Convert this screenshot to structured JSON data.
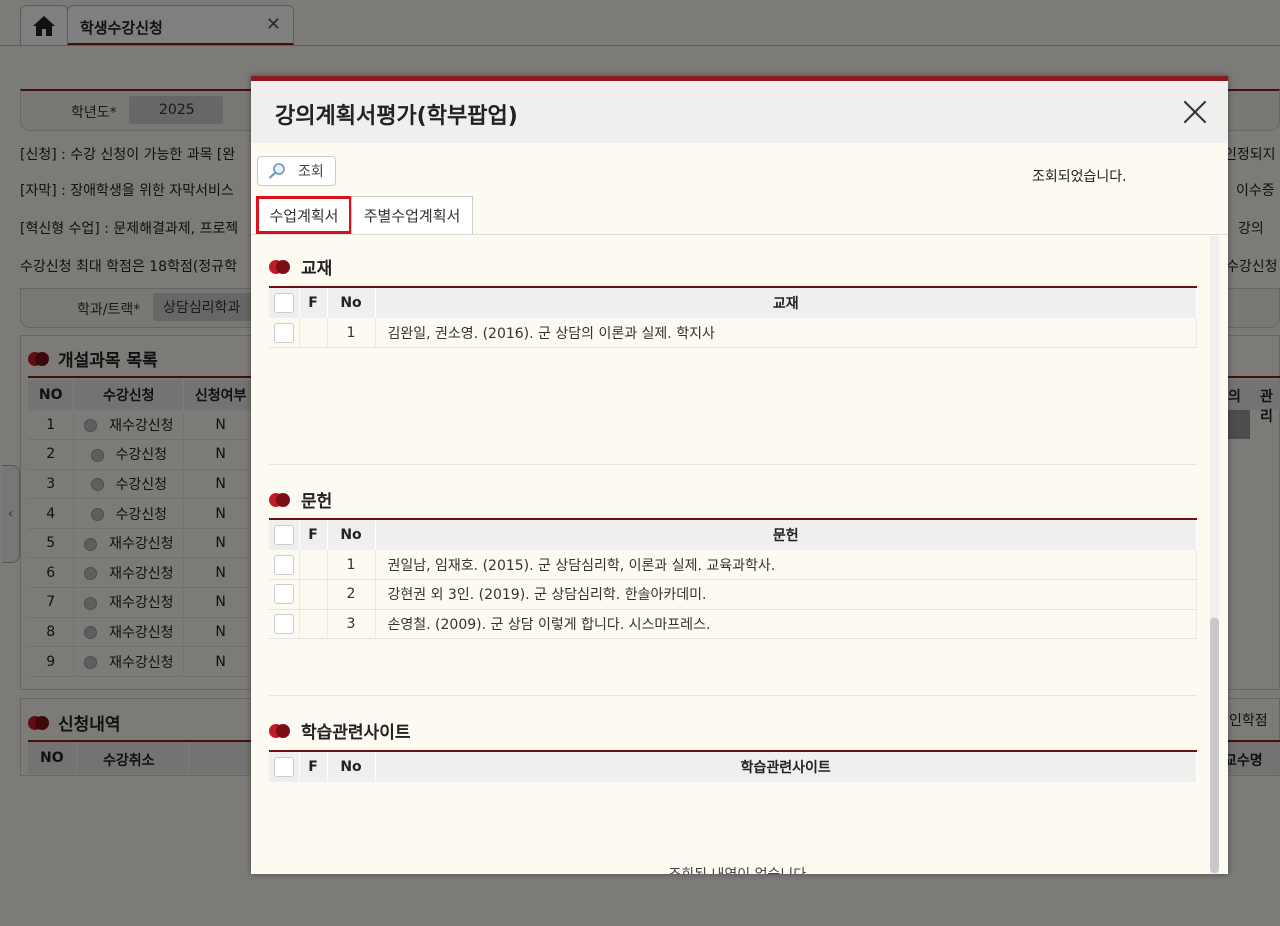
{
  "page_tab": {
    "label": "학생수강신청",
    "close": "✕"
  },
  "conditions": {
    "year_label": "학년도*",
    "year_value": "2025",
    "dept_label": "학과/트랙*",
    "dept_value": "상담심리학과"
  },
  "notices": [
    {
      "left": "[신청] : 수강 신청이 가능한 과목 [완",
      "right": "인정되지"
    },
    {
      "left": "[자막] : 장애학생을 위한 자막서비스",
      "right": "이수증"
    },
    {
      "left": "[혁신형 수업] : 문제해결과제, 프로젝",
      "right": "강의"
    },
    {
      "left": "수강신청 최대 학점은 18학점(정규학",
      "right": "수강신청"
    }
  ],
  "course_list": {
    "title": "개설과목 목록",
    "columns": [
      "NO",
      "수강신청",
      "신청여부"
    ],
    "right_columns": [
      "의",
      "관리"
    ],
    "rows": [
      {
        "no": "1",
        "action": "재수강신청",
        "status": "N"
      },
      {
        "no": "2",
        "action": "수강신청",
        "status": "N"
      },
      {
        "no": "3",
        "action": "수강신청",
        "status": "N"
      },
      {
        "no": "4",
        "action": "수강신청",
        "status": "N"
      },
      {
        "no": "5",
        "action": "재수강신청",
        "status": "N"
      },
      {
        "no": "6",
        "action": "재수강신청",
        "status": "N"
      },
      {
        "no": "7",
        "action": "재수강신청",
        "status": "N"
      },
      {
        "no": "8",
        "action": "재수강신청",
        "status": "N"
      },
      {
        "no": "9",
        "action": "재수강신청",
        "status": "N"
      }
    ]
  },
  "applied": {
    "title": "신청내역",
    "columns": [
      "NO",
      "수강취소"
    ],
    "right_label": "인학점",
    "right_column": "교수명"
  },
  "modal": {
    "title": "강의계획서평가(학부팝업)",
    "search_label": "조회",
    "status": "조회되었습니다.",
    "tabs": [
      "수업계획서",
      "주별수업계획서"
    ],
    "sections": [
      {
        "title": "교재",
        "columns": [
          "F",
          "No",
          "교재"
        ],
        "rows": [
          {
            "no": "1",
            "text": "김완일, 권소영. (2016). 군 상담의 이론과 실제. 학지사"
          }
        ]
      },
      {
        "title": "문헌",
        "columns": [
          "F",
          "No",
          "문헌"
        ],
        "rows": [
          {
            "no": "1",
            "text": "권일남, 임재호. (2015). 군 상담심리학, 이론과 실제. 교육과학사."
          },
          {
            "no": "2",
            "text": "강현권 외 3인. (2019). 군 상담심리학. 한솔아카데미."
          },
          {
            "no": "3",
            "text": "손영철. (2009). 군 상담 이렇게 합니다. 시스마프레스."
          }
        ]
      },
      {
        "title": "학습관련사이트",
        "columns": [
          "F",
          "No",
          "학습관련사이트"
        ],
        "rows": [],
        "empty_message": "조회된 내역이 없습니다."
      }
    ]
  },
  "colors": {
    "accent": "#8d1a1f",
    "active_tab_border": "#d9111c",
    "dot_red": "#c21b26"
  }
}
